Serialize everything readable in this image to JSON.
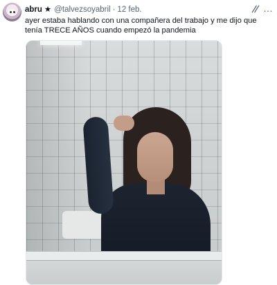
{
  "tweet": {
    "name": "abru",
    "name_badge": "★",
    "handle": "@talvezsoyabril",
    "separator": "·",
    "date": "12 feb.",
    "text": "ayer estaba hablando con una compañera del trabajo y me dijo que tenía TRECE AÑOS cuando empezó la pandemia",
    "more_icon": "…"
  },
  "icons": {
    "avatar": "avatar",
    "grok": "grok-icon",
    "more": "more-icon"
  },
  "colors": {
    "text_primary": "#0f1419",
    "text_secondary": "#536471"
  }
}
